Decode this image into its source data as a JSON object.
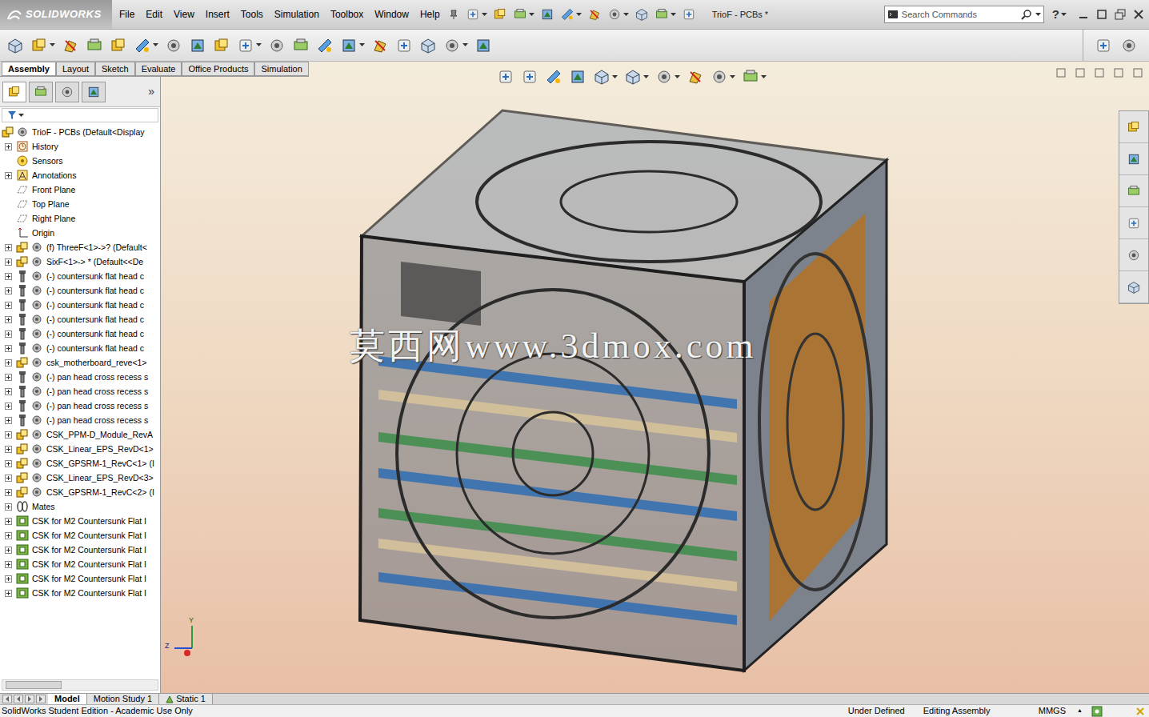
{
  "app": {
    "logo": "SOLIDWORKS",
    "title": "TrioF - PCBs *"
  },
  "menu": [
    "File",
    "Edit",
    "View",
    "Insert",
    "Tools",
    "Simulation",
    "Toolbox",
    "Window",
    "Help"
  ],
  "search": {
    "placeholder": "Search Commands"
  },
  "help": "?",
  "command_tabs": [
    {
      "label": "Assembly",
      "selected": true
    },
    {
      "label": "Layout",
      "selected": false
    },
    {
      "label": "Sketch",
      "selected": false
    },
    {
      "label": "Evaluate",
      "selected": false
    },
    {
      "label": "Office Products",
      "selected": false
    },
    {
      "label": "Simulation",
      "selected": false
    }
  ],
  "panel_more": "»",
  "tree": {
    "items": [
      {
        "label": "TrioF - PCBs  (Default<Display",
        "kind": "root",
        "expandable": false
      },
      {
        "label": "History",
        "kind": "history",
        "expandable": true
      },
      {
        "label": "Sensors",
        "kind": "sensor",
        "expandable": false
      },
      {
        "label": "Annotations",
        "kind": "annotation",
        "expandable": true
      },
      {
        "label": "Front Plane",
        "kind": "plane",
        "expandable": false
      },
      {
        "label": "Top Plane",
        "kind": "plane",
        "expandable": false
      },
      {
        "label": "Right Plane",
        "kind": "plane",
        "expandable": false
      },
      {
        "label": "Origin",
        "kind": "origin",
        "expandable": false
      },
      {
        "label": "(f) ThreeF<1>->? (Default<",
        "kind": "assembly",
        "expandable": true
      },
      {
        "label": "SixF<1>-> * (Default<<De",
        "kind": "assembly",
        "expandable": true
      },
      {
        "label": "(-) countersunk flat head c",
        "kind": "part",
        "expandable": true
      },
      {
        "label": "(-) countersunk flat head c",
        "kind": "part",
        "expandable": true
      },
      {
        "label": "(-) countersunk flat head c",
        "kind": "part",
        "expandable": true
      },
      {
        "label": "(-) countersunk flat head c",
        "kind": "part",
        "expandable": true
      },
      {
        "label": "(-) countersunk flat head c",
        "kind": "part",
        "expandable": true
      },
      {
        "label": "(-) countersunk flat head c",
        "kind": "part",
        "expandable": true
      },
      {
        "label": "csk_motherboard_reve<1>",
        "kind": "assembly",
        "expandable": true
      },
      {
        "label": "(-) pan head cross recess s",
        "kind": "part",
        "expandable": true
      },
      {
        "label": "(-) pan head cross recess s",
        "kind": "part",
        "expandable": true
      },
      {
        "label": "(-) pan head cross recess s",
        "kind": "part",
        "expandable": true
      },
      {
        "label": "(-) pan head cross recess s",
        "kind": "part",
        "expandable": true
      },
      {
        "label": "CSK_PPM-D_Module_RevA",
        "kind": "assembly",
        "expandable": true
      },
      {
        "label": "CSK_Linear_EPS_RevD<1>",
        "kind": "assembly",
        "expandable": true
      },
      {
        "label": "CSK_GPSRM-1_RevC<1> (I",
        "kind": "assembly",
        "expandable": true
      },
      {
        "label": "CSK_Linear_EPS_RevD<3>",
        "kind": "assembly",
        "expandable": true
      },
      {
        "label": "CSK_GPSRM-1_RevC<2> (I",
        "kind": "assembly",
        "expandable": true
      },
      {
        "label": "Mates",
        "kind": "mates",
        "expandable": true
      },
      {
        "label": "CSK for M2 Countersunk Flat I",
        "kind": "hole",
        "expandable": true
      },
      {
        "label": "CSK for M2 Countersunk Flat I",
        "kind": "hole",
        "expandable": true
      },
      {
        "label": "CSK for M2 Countersunk Flat I",
        "kind": "hole",
        "expandable": true
      },
      {
        "label": "CSK for M2 Countersunk Flat I",
        "kind": "hole",
        "expandable": true
      },
      {
        "label": "CSK for M2 Countersunk Flat I",
        "kind": "hole",
        "expandable": true
      },
      {
        "label": "CSK for M2 Countersunk Flat I",
        "kind": "hole",
        "expandable": true
      }
    ]
  },
  "watermark": "莫西网www.3dmox.com",
  "triad": [
    "Y",
    "Z"
  ],
  "bottom_tabs": [
    {
      "label": "Model",
      "selected": true
    },
    {
      "label": "Motion Study 1",
      "selected": false
    },
    {
      "label": "Static 1",
      "selected": false
    }
  ],
  "status_bar": {
    "edition": "SolidWorks Student Edition - Academic Use Only",
    "state": "Under Defined",
    "mode": "Editing Assembly",
    "units": "MMGS",
    "units_arrow": "▲"
  }
}
